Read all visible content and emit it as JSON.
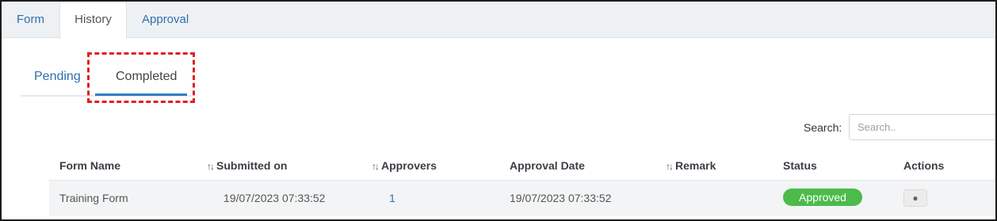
{
  "top_tabs": [
    {
      "label": "Form",
      "active": false
    },
    {
      "label": "History",
      "active": true
    },
    {
      "label": "Approval",
      "active": false
    }
  ],
  "sub_tabs": [
    {
      "label": "Pending",
      "active": false
    },
    {
      "label": "Completed",
      "active": true
    }
  ],
  "search": {
    "label": "Search:",
    "placeholder": "Search.."
  },
  "table": {
    "columns": [
      "Form Name",
      "Submitted on",
      "Approvers",
      "Approval Date",
      "Remark",
      "Status",
      "Actions"
    ],
    "rows": [
      {
        "form_name": "Training Form",
        "submitted_on": "19/07/2023 07:33:52",
        "approvers": "1",
        "approval_date": "19/07/2023 07:33:52",
        "remark": "",
        "status": "Approved",
        "action_icon": "eye-icon"
      }
    ]
  },
  "colors": {
    "accent": "#2f6fab",
    "underline": "#2f7fc8",
    "status_approved": "#4cbb4a",
    "highlight": "#e02020"
  }
}
